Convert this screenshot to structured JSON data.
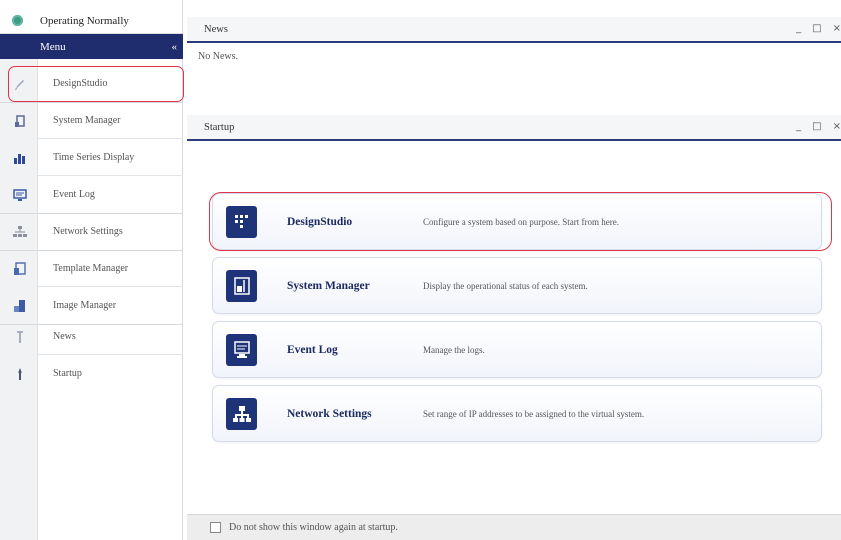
{
  "status": {
    "text": "Operating Normally",
    "color": "#3f9a86"
  },
  "menu": {
    "title": "Menu",
    "collapse_icon": "double-chevron-left-icon",
    "collapse_glyph": "«"
  },
  "sidebar": {
    "items": [
      {
        "label": "DesignStudio",
        "icon": "pencil-icon"
      },
      {
        "label": "System Manager",
        "icon": "system-manager-icon"
      },
      {
        "label": "Time Series Display",
        "icon": "bar-chart-icon"
      },
      {
        "label": "Event Log",
        "icon": "event-log-icon"
      },
      {
        "label": "Network Settings",
        "icon": "network-icon"
      },
      {
        "label": "Template Manager",
        "icon": "template-icon"
      },
      {
        "label": "Image Manager",
        "icon": "image-icon"
      },
      {
        "label": "News",
        "icon": "news-icon"
      },
      {
        "label": "Startup",
        "icon": "startup-icon"
      }
    ]
  },
  "news": {
    "title": "News",
    "body": "No News.",
    "controls": {
      "minimize": "_",
      "maximize": "□",
      "close": "×"
    }
  },
  "startup": {
    "title": "Startup",
    "controls": {
      "minimize": "_",
      "maximize": "□",
      "close": "×"
    },
    "cards": [
      {
        "title": "DesignStudio",
        "description": "Configure a system based on purpose. Start from here.",
        "icon": "grid-dots-icon"
      },
      {
        "title": "System Manager",
        "description": "Display the operational status of each system.",
        "icon": "system-panel-icon"
      },
      {
        "title": "Event Log",
        "description": "Manage the logs.",
        "icon": "monitor-log-icon"
      },
      {
        "title": "Network Settings",
        "description": "Set range of IP addresses to be assigned to the virtual system.",
        "icon": "network-tree-icon"
      }
    ]
  },
  "footer": {
    "checkbox_label": "Do not show this window again at startup.",
    "checked": false
  },
  "colors": {
    "accent": "#1f2d6f",
    "card_icon_bg": "#1f3378",
    "highlight": "#e0334a"
  }
}
